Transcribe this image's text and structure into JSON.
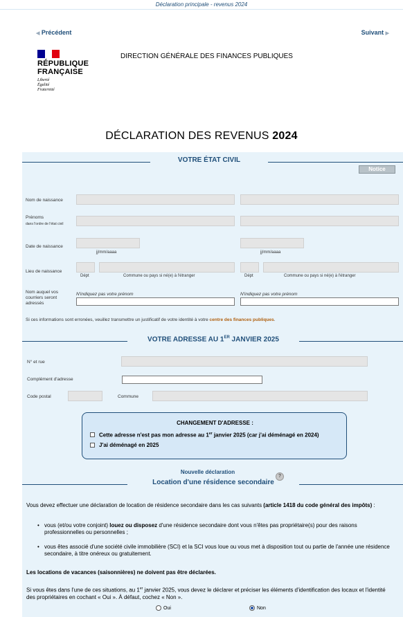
{
  "header": {
    "top_caption": "Déclaration principale - revenus 2024",
    "prev_label": "Précédent",
    "next_label": "Suivant",
    "brand_line1": "RÉPUBLIQUE",
    "brand_line2": "FRANÇAISE",
    "motto_1": "Liberté",
    "motto_2": "Égalité",
    "motto_3": "Fraternité",
    "org": "DIRECTION GÉNÉRALE DES FINANCES PUBLIQUES",
    "title_prefix": "DÉCLARATION DES REVENUS ",
    "title_year": "2024"
  },
  "colors": {
    "brand_blue": "#000091",
    "brand_red": "#e1000f",
    "accent": "#1f4e79",
    "panel": "#e8f3fa"
  },
  "etat_civil": {
    "title": "VOTRE ÉTAT CIVIL",
    "notice": "Notice",
    "nom_label": "Nom de naissance",
    "prenoms_label": "Prénoms",
    "prenoms_sub": "dans l'ordre de l'état civil",
    "date_label": "Date de naissance",
    "date_hint": "jj/mm/aaaa",
    "lieu_label": "Lieu de naissance",
    "dept_hint": "Dépt",
    "commune_hint": "Commune ou pays si né(e) à l'étranger",
    "courrier_label_1": "Nom auquel vos",
    "courrier_label_2": "courriers seront",
    "courrier_label_3": "adressés",
    "courrier_hint": "N'indiquez pas votre prénom",
    "info_text": "Si ces informations sont erronées, veuillez transmettre un justificatif de votre identité à votre ",
    "info_link": "centre des finances publiques",
    "info_end": "."
  },
  "adresse": {
    "title_pre": "VOTRE ADRESSE AU 1",
    "title_sup": "ER",
    "title_post": " JANVIER 2025",
    "num_label": "N° et rue",
    "complement_label": "Complément d'adresse",
    "cp_label": "Code postal",
    "commune_label": "Commune"
  },
  "changement": {
    "title": "CHANGEMENT D'ADRESSE :",
    "opt1_pre": "Cette adresse n'est pas mon adresse au 1",
    "opt1_sup": "er",
    "opt1_post": " janvier 2025 (car j'ai déménagé en 2024)",
    "opt2": "J'ai déménagé en 2025"
  },
  "location": {
    "new_label": "Nouvelle déclaration",
    "title": "Location d'une résidence secondaire",
    "help": "?",
    "intro": "Vous devez effectuer une déclaration de location de résidence secondaire dans les cas suivants ",
    "intro_bold": "(article 1418 du code général des impôts)",
    "intro_end": " :",
    "b1_pre": "vous (et/ou votre conjoint) ",
    "b1_bold": "louez ou disposez",
    "b1_post": " d'une résidence secondaire dont vous n'êtes pas propriétaire(s) pour des raisons professionnelles ou personnelles ;",
    "b2": "vous êtes associé d'une société civile immobilière (SCI) et la SCI vous loue ou vous met à disposition tout ou partie de l'année une résidence secondaire, à titre onéreux ou gratuitement.",
    "vacances": "Les locations de vacances (saisonnières) ne doivent pas être déclarées.",
    "instr_pre": "Si vous êtes dans l'une de ces situations, au 1",
    "instr_sup": "er",
    "instr_post": " janvier 2025, vous devez le déclarer et préciser les éléments d'identification des locaux et l'identité des propriétaires en cochant « Oui ». À défaut, cochez « Non ».",
    "oui": "Oui",
    "non": "Non",
    "selected": "Non"
  }
}
